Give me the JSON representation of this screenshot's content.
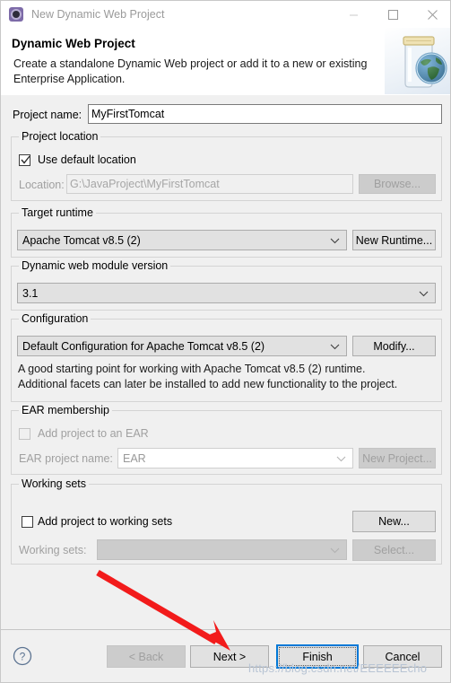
{
  "window": {
    "title": "New Dynamic Web Project",
    "icon": "eclipse-wizard-icon",
    "controls": {
      "minimize": "minimize-icon",
      "maximize": "maximize-icon",
      "close": "close-icon"
    }
  },
  "banner": {
    "title": "Dynamic Web Project",
    "description": "Create a standalone Dynamic Web project or add it to a new or existing Enterprise Application.",
    "artwork": "jar-with-globe-icon"
  },
  "project_name": {
    "label": "Project name:",
    "value": "MyFirstTomcat",
    "placeholder": ""
  },
  "project_location": {
    "group_label": "Project location",
    "use_default_label": "Use default location",
    "use_default_checked": true,
    "location_label": "Location:",
    "location_value": "G:\\JavaProject\\MyFirstTomcat",
    "browse_label": "Browse...",
    "browse_enabled": false
  },
  "target_runtime": {
    "group_label": "Target runtime",
    "selected": "Apache Tomcat v8.5 (2)",
    "new_runtime_label": "New Runtime...",
    "options": [
      "Apache Tomcat v8.5 (2)"
    ]
  },
  "module_version": {
    "group_label": "Dynamic web module version",
    "selected": "3.1",
    "options": [
      "3.1"
    ]
  },
  "configuration": {
    "group_label": "Configuration",
    "selected": "Default Configuration for Apache Tomcat v8.5 (2)",
    "modify_label": "Modify...",
    "description_line1": "A good starting point for working with Apache Tomcat v8.5 (2) runtime.",
    "description_line2": "Additional facets can later be installed to add new functionality to the project.",
    "options": [
      "Default Configuration for Apache Tomcat v8.5 (2)"
    ]
  },
  "ear_membership": {
    "group_label": "EAR membership",
    "add_to_ear_label": "Add project to an EAR",
    "add_to_ear_checked": false,
    "ear_project_name_label": "EAR project name:",
    "ear_project_name_value": "EAR",
    "new_project_label": "New Project...",
    "enabled": false
  },
  "working_sets": {
    "group_label": "Working sets",
    "add_to_working_sets_label": "Add project to working sets",
    "add_to_working_sets_checked": false,
    "working_sets_label": "Working sets:",
    "working_sets_value": "",
    "new_label": "New...",
    "select_label": "Select...",
    "select_enabled": false
  },
  "buttons": {
    "help": "help-icon",
    "back": "< Back",
    "back_enabled": false,
    "next": "Next >",
    "finish": "Finish",
    "cancel": "Cancel",
    "default_button": "Finish"
  },
  "annotation": {
    "arrow_color": "#f21b1b",
    "arrow_target": "next-button",
    "watermark": "https://blog.csdn.net/EEEEEEcho"
  },
  "colors": {
    "dialog_bg": "#f0f0f0",
    "accent": "#0078d7",
    "banner_bg": "#ffffff",
    "disabled_text": "#a0a0a0"
  }
}
